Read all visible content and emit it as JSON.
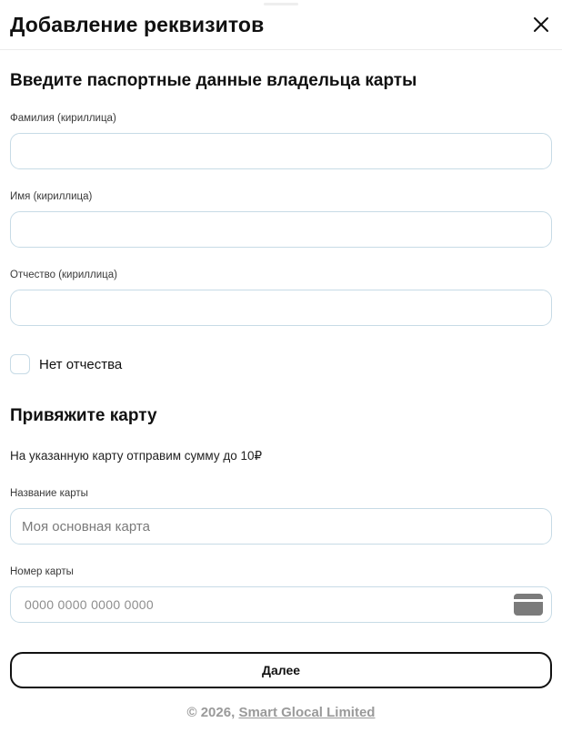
{
  "header": {
    "title": "Добавление реквизитов",
    "close_icon": "close-icon"
  },
  "passport_section": {
    "title": "Введите паспортные данные владельца карты",
    "surname": {
      "label": "Фамилия (кириллица)",
      "value": "",
      "placeholder": ""
    },
    "first_name": {
      "label": "Имя (кириллица)",
      "value": "",
      "placeholder": ""
    },
    "patronymic": {
      "label": "Отчество (кириллица)",
      "value": "",
      "placeholder": ""
    },
    "no_patronymic": {
      "label": "Нет отчества",
      "checked": false
    }
  },
  "card_section": {
    "title": "Привяжите карту",
    "hint": "На указанную карту отправим сумму до 10₽",
    "card_name": {
      "label": "Название карты",
      "value": "",
      "placeholder": "Моя основная карта"
    },
    "card_number": {
      "label": "Номер карты",
      "value": "",
      "placeholder": "0000 0000 0000 0000",
      "icon": "credit-card-icon"
    }
  },
  "actions": {
    "next_label": "Далее"
  },
  "footer": {
    "copyright": "© 2026, ",
    "company": "Smart Glocal Limited"
  },
  "colors": {
    "text": "#111111",
    "input_border": "#c7dbe6",
    "muted": "#9a9a9a",
    "icon_gray": "#7b7b7b"
  }
}
